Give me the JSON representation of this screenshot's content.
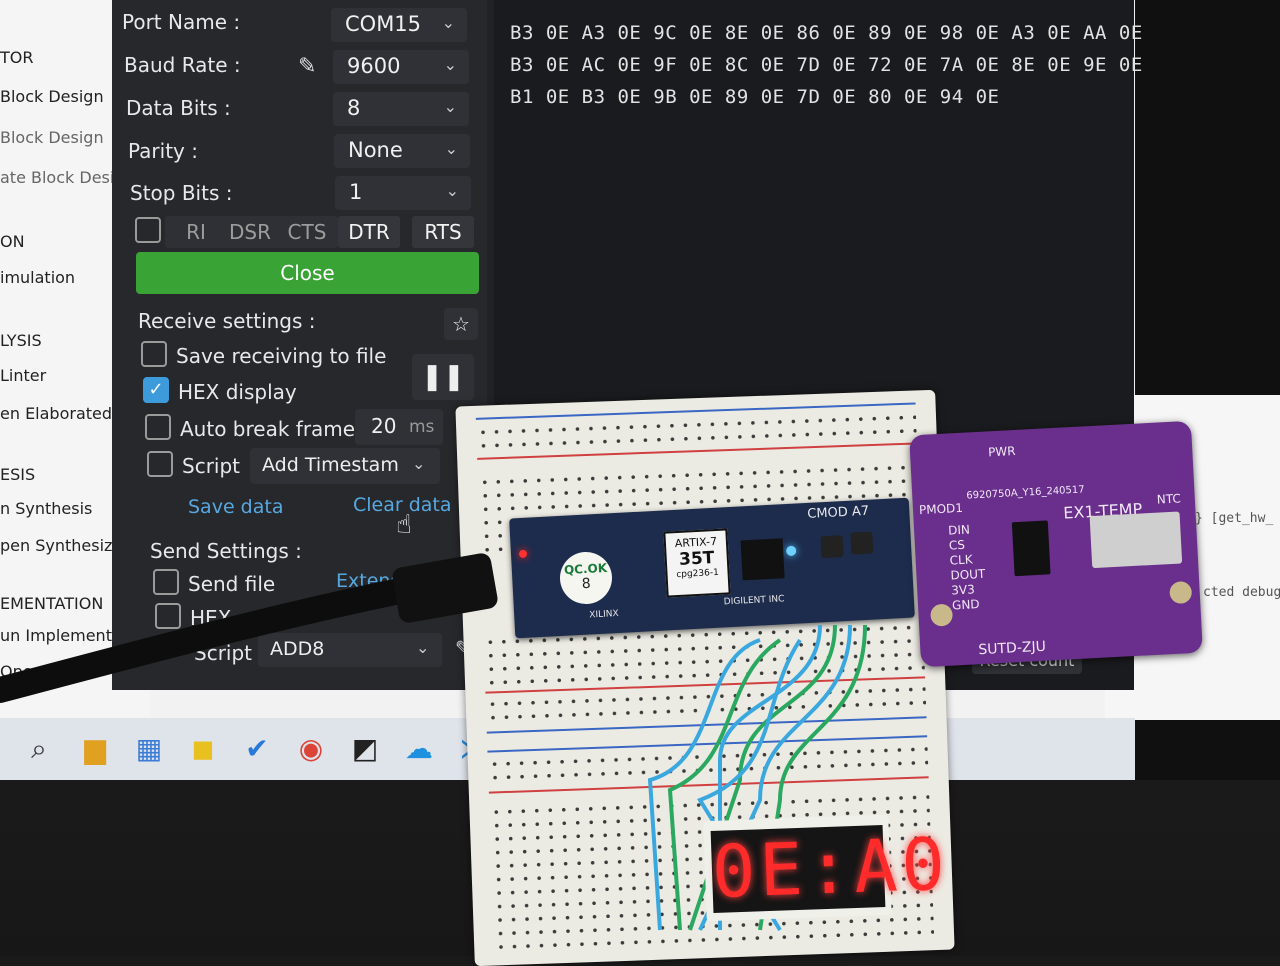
{
  "flow_panel": {
    "items": [
      "TOR",
      "Block Design",
      "Block Design",
      "ate Block Design",
      "ON",
      "imulation",
      "LYSIS",
      "Linter",
      "en Elaborated Desig",
      "ESIS",
      "n Synthesis",
      "pen Synthesized Desi",
      "EMENTATION",
      "un Implementation",
      "Open Im"
    ]
  },
  "serial": {
    "port_name_label": "Port Name :",
    "port_name_value": "COM15",
    "baud_rate_label": "Baud Rate :",
    "baud_rate_value": "9600",
    "data_bits_label": "Data Bits :",
    "data_bits_value": "8",
    "parity_label": "Parity :",
    "parity_value": "None",
    "stop_bits_label": "Stop Bits :",
    "stop_bits_value": "1",
    "signals": [
      "RI",
      "DSR",
      "CTS",
      "DTR",
      "RTS"
    ],
    "close_label": "Close",
    "receive_settings_label": "Receive settings :",
    "save_receiving_label": "Save receiving to file",
    "hex_display_label": "HEX display",
    "auto_break_label": "Auto break frame",
    "auto_break_value": "20",
    "auto_break_unit": "ms",
    "script_label": "Script",
    "script_value": "Add Timestam",
    "save_data_label": "Save data",
    "clear_data_label": "Clear data",
    "send_settings_label": "Send Settings :",
    "send_file_label": "Send file",
    "extens_label": "Extens",
    "hex_send_label": "HEX se",
    "send_script_label": "Script",
    "send_script_value": "ADD8",
    "reset_count_label": "Reset count"
  },
  "hex_output": [
    "B3 0E A3 0E 9C 0E 8E 0E 86 0E 89 0E 98 0E A3 0E AA 0E",
    "B3 0E AC 0E 9F 0E 8C 0E 7D 0E 72 0E 7A 0E 8E 0E 9E 0E",
    "B1 0E B3 0E 9B 0E 89 0E 7D 0E 80 0E 94 0E"
  ],
  "code_strip": [
    "} [get_hw_",
    "cted debug"
  ],
  "hardware": {
    "fpga_board_label": "CMOD A7",
    "fpga_chip_line1": "ARTIX-7",
    "fpga_chip_line2": "35T",
    "fpga_chip_line3": "cpg236-1",
    "qc_label": "QC.OK",
    "qc_num": "8",
    "digilent_label": "DIGILENT INC",
    "xilinx_label": "XILINX",
    "pmod_label": "PMOD1",
    "pmod_title": "EX1-TEMP",
    "pmod_serial": "6920750A_Y16_240517",
    "pmod_brand": "SUTD-ZJU",
    "pmod_pins": [
      "DIN",
      "CS",
      "CLK",
      "DOUT",
      "3V3",
      "GND"
    ],
    "pwr_label": "PWR",
    "ntc_label": "NTC",
    "seven_segment_display": "0E:A0"
  }
}
